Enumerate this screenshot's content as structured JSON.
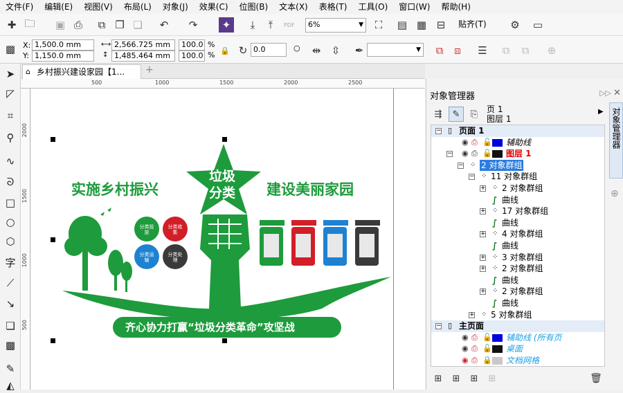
{
  "menubar": {
    "items": [
      "文件(F)",
      "编辑(E)",
      "视图(V)",
      "布局(L)",
      "对象(J)",
      "效果(C)",
      "位图(B)",
      "文本(X)",
      "表格(T)",
      "工具(O)",
      "窗口(W)",
      "帮助(H)"
    ]
  },
  "toolbar": {
    "zoom": "6%",
    "snap_label": "贴齐(T)"
  },
  "propbar": {
    "x": "1,500.0 mm",
    "y": "1,150.0 mm",
    "width": "2,566.725 mm",
    "height": "1,485.464 mm",
    "scale_x": "100.0",
    "scale_y": "100.0",
    "percent": "%",
    "rotation": "0.0",
    "x_label": "X:",
    "y_label": "Y:",
    "pdf_label": "PDF"
  },
  "tab": {
    "title": "乡村振兴建设家园【1..."
  },
  "ruler": {
    "h_ticks": [
      "500",
      "1000",
      "1500",
      "2000",
      "2500"
    ],
    "v_ticks": [
      "2000",
      "1500",
      "1000",
      "500"
    ]
  },
  "design": {
    "left_slogan": "实施乡村振兴",
    "right_slogan": "建设美丽家园",
    "star_text_1": "垃圾",
    "star_text_2": "分类",
    "circle_1": "分类投放",
    "circle_2": "分类收集",
    "circle_3": "分类运输",
    "circle_4": "分类处理",
    "bottom_banner": "齐心协力打赢“垃圾分类革命”攻坚战",
    "colors": {
      "green": "#1e9b3c",
      "red": "#d21e28",
      "blue": "#1e82d2",
      "dark": "#3a3a3a"
    }
  },
  "docker": {
    "title": "对象管理器",
    "side_tab": "对象管理器",
    "page_label": "页 1",
    "layer_label": "图层 1",
    "tree": [
      {
        "label": "页面 1",
        "bold": true
      },
      {
        "label": "辅助线",
        "italic": true,
        "color": "#0000e0"
      },
      {
        "label": "图层 1",
        "bold": true,
        "textcolor": "#e00000",
        "color": "#111111"
      },
      {
        "label": "2 对象群组",
        "selected": true
      },
      {
        "label": "11 对象群组"
      },
      {
        "label": "2 对象群组"
      },
      {
        "label": "曲线"
      },
      {
        "label": "17 对象群组"
      },
      {
        "label": "曲线"
      },
      {
        "label": "4 对象群组"
      },
      {
        "label": "曲线"
      },
      {
        "label": "3 对象群组"
      },
      {
        "label": "2 对象群组"
      },
      {
        "label": "曲线"
      },
      {
        "label": "2 对象群组"
      },
      {
        "label": "曲线"
      },
      {
        "label": "5 对象群组"
      },
      {
        "label": "主页面",
        "bold": true
      },
      {
        "label": "辅助线 (所有页",
        "italic": true,
        "textcolor": "#1ea0e6",
        "color": "#0000e0"
      },
      {
        "label": "桌面",
        "italic": true,
        "textcolor": "#1ea0e6",
        "color": "#111111"
      },
      {
        "label": "文档网格",
        "italic": true,
        "textcolor": "#1ea0e6",
        "color": "#c8c8c8"
      }
    ]
  }
}
